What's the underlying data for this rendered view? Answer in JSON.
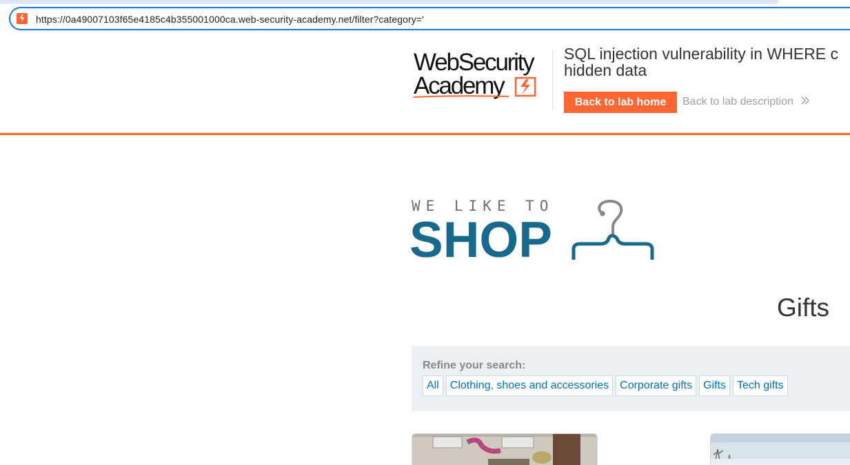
{
  "browser": {
    "url": "https://0a49007103f65e4185c4b355001000ca.web-security-academy.net/filter?category='",
    "site_icon": "portswigger-favicon-icon"
  },
  "header": {
    "logo_line1": "WebSecurity",
    "logo_line2": "Academy",
    "lab_title_line1": "SQL injection vulnerability in WHERE c",
    "lab_title_line2": "hidden data",
    "back_home_label": "Back to lab home",
    "back_description_label": "Back to lab description"
  },
  "shop_logo": {
    "tagline": "WE LIKE TO",
    "word": "SHOP"
  },
  "category_heading": "Gifts",
  "filters": {
    "label": "Refine your search:",
    "items": [
      "All",
      "Clothing, shoes and accessories",
      "Corporate gifts",
      "Gifts",
      "Tech gifts"
    ]
  },
  "colors": {
    "accent_orange": "#ff6633",
    "shop_blue": "#17698e",
    "link_blue": "#0071bc",
    "panel_bg": "#ebf0f2"
  }
}
